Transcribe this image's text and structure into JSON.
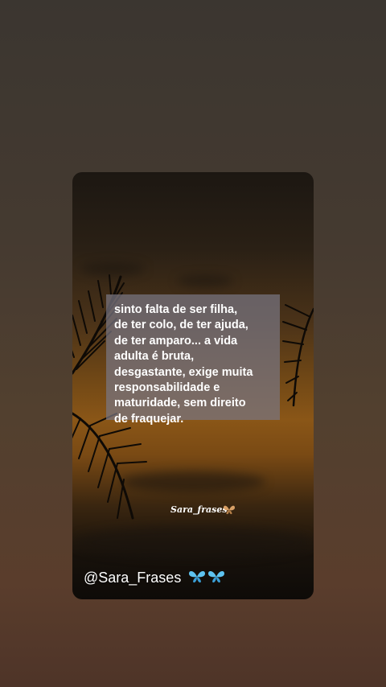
{
  "quote": {
    "text": "sinto falta de ser filha,\nde ter colo, de ter ajuda,\nde ter amparo... a vida\nadulta é bruta,\ndesgastante, exige muita\nresponsabilidade e\nmaturidade, sem direito\nde fraquejar."
  },
  "signature": {
    "text": "Sara_frases"
  },
  "footer": {
    "handle": "@Sara_Frases"
  },
  "icons": [
    "butterfly-orange-icon",
    "butterfly-blue-icon"
  ],
  "colors": {
    "quote_box": "#78768299",
    "butterfly_blue": "#5ec3f0",
    "butterfly_orange": "#d9a066"
  }
}
